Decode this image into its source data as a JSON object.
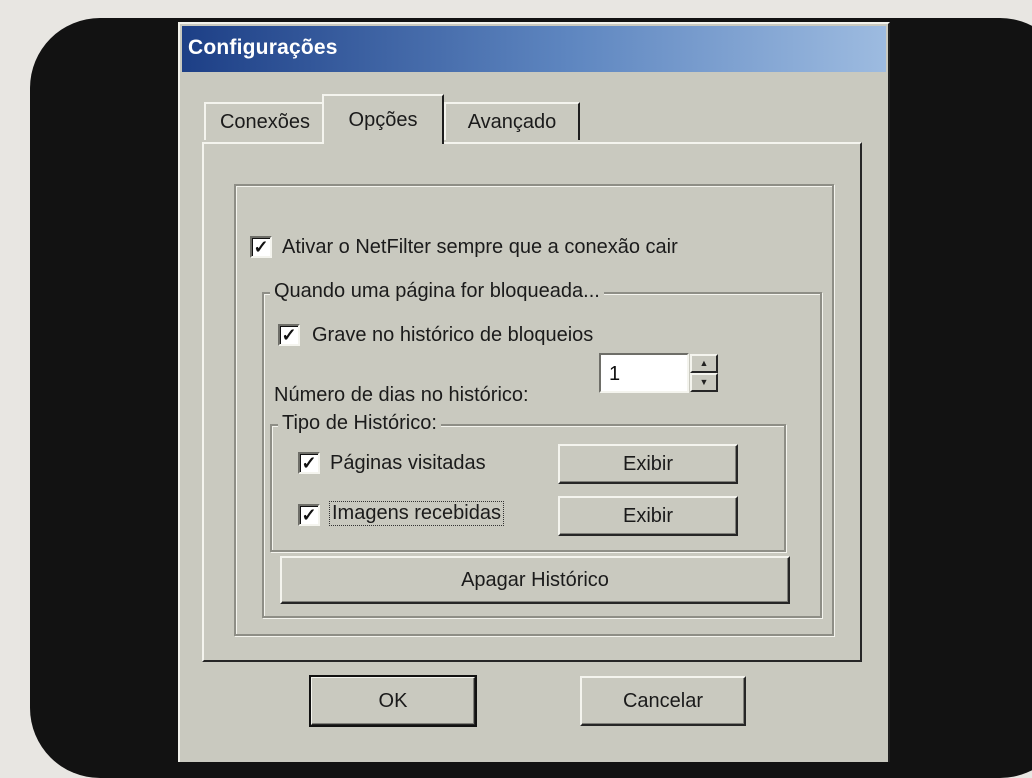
{
  "window": {
    "title": "Configurações"
  },
  "tabs": [
    {
      "label": "Conexões",
      "active": false
    },
    {
      "label": "Opções",
      "active": true
    },
    {
      "label": "Avançado",
      "active": false
    }
  ],
  "options": {
    "activate_on_disconnect": {
      "label": "Ativar o NetFilter sempre que a conexão cair",
      "checked": true
    },
    "blocked_group": {
      "legend": "Quando uma página for bloqueada...",
      "record_history": {
        "label": "Grave no histórico de bloqueios",
        "checked": true
      },
      "days_label": "Número de dias no histórico:",
      "days_value": "1",
      "history_type": {
        "legend": "Tipo de Histórico:",
        "visited_pages": {
          "label": "Páginas visitadas",
          "checked": true,
          "button": "Exibir"
        },
        "received_images": {
          "label": "Imagens recebidas",
          "checked": true,
          "button": "Exibir"
        }
      },
      "clear_history_button": "Apagar Histórico"
    }
  },
  "footer": {
    "ok_label": "OK",
    "cancel_label": "Cancelar"
  },
  "icons": {
    "check": "✓",
    "spin_up": "▲",
    "spin_down": "▼"
  },
  "colors": {
    "titlebar_start": "#1d3f86",
    "titlebar_end": "#9dbbe0",
    "dialog_face": "#c9c9bf"
  }
}
